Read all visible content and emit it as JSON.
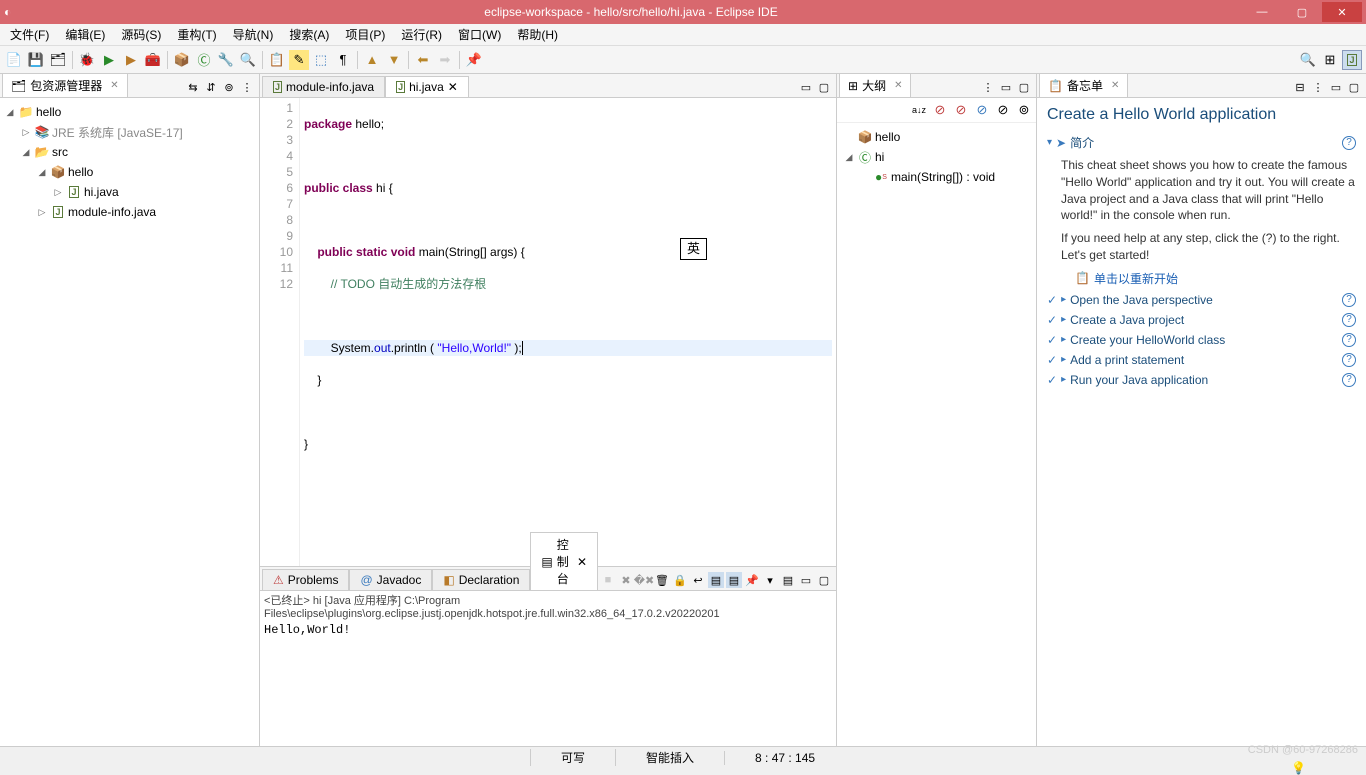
{
  "title": "eclipse-workspace - hello/src/hello/hi.java - Eclipse IDE",
  "menus": [
    "文件(F)",
    "编辑(E)",
    "源码(S)",
    "重构(T)",
    "导航(N)",
    "搜索(A)",
    "项目(P)",
    "运行(R)",
    "窗口(W)",
    "帮助(H)"
  ],
  "explorer": {
    "title": "包资源管理器",
    "project": "hello",
    "jre": "JRE 系统库 [JavaSE-17]",
    "src": "src",
    "pkg": "hello",
    "files": [
      "hi.java",
      "module-info.java"
    ]
  },
  "editor": {
    "tabs": [
      "module-info.java",
      "hi.java"
    ],
    "active": 1,
    "lines": [
      "1",
      "2",
      "3",
      "4",
      "5",
      "6",
      "7",
      "8",
      "9",
      "10",
      "11",
      "12"
    ],
    "code": {
      "l1a": "package",
      "l1b": " hello;",
      "l3a": "public class",
      "l3b": " hi {",
      "l5a": "public static void",
      "l5b": " main(String[] args) {",
      "l6a": "// TODO 自动生成的方法存根",
      "l8a": "System.",
      "l8b": "out",
      "l8c": ".println ( ",
      "l8d": "\"Hello,World!\"",
      "l8e": " );",
      "l9": "    }",
      "l11": "}"
    },
    "ime": "英"
  },
  "outline": {
    "title": "大纲",
    "pkg": "hello",
    "cls": "hi",
    "method": "main(String[]) : void"
  },
  "cheatsheet": {
    "tab": "备忘单",
    "heading": "Create a Hello World application",
    "intro_label": "简介",
    "intro_p1": "This cheat sheet shows you how to create the famous \"Hello World\" application and try it out. You will create a Java project and a Java class that will print \"Hello world!\" in the console when run.",
    "intro_p2": "If you need help at any step, click the (?) to the right. Let's get started!",
    "restart": "单击以重新开始",
    "steps": [
      "Open the Java perspective",
      "Create a Java project",
      "Create your HelloWorld class",
      "Add a print statement",
      "Run your Java application"
    ]
  },
  "bottom": {
    "tabs": [
      "Problems",
      "Javadoc",
      "Declaration",
      "控制台"
    ],
    "active": 3,
    "console_header": "<已终止> hi [Java 应用程序] C:\\Program Files\\eclipse\\plugins\\org.eclipse.justj.openjdk.hotspot.jre.full.win32.x86_64_17.0.2.v20220201",
    "console_out": "Hello,World!"
  },
  "status": {
    "mode": "可写",
    "insert": "智能插入",
    "pos": "8 : 47 : 145"
  },
  "watermark": "CSDN @60-97268286"
}
